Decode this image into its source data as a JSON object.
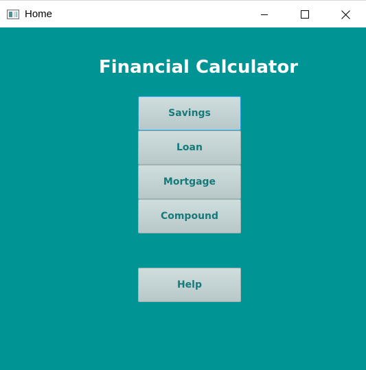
{
  "window": {
    "title": "Home",
    "controls": {
      "minimize_icon": "minimize-icon",
      "maximize_icon": "maximize-icon",
      "close_icon": "close-icon"
    }
  },
  "main": {
    "heading": "Financial Calculator",
    "buttons": [
      {
        "label": "Savings",
        "focused": true
      },
      {
        "label": "Loan",
        "focused": false
      },
      {
        "label": "Mortgage",
        "focused": false
      },
      {
        "label": "Compound",
        "focused": false
      }
    ],
    "help_button": {
      "label": "Help"
    }
  },
  "colors": {
    "background": "#009494",
    "heading_text": "#ffffff",
    "button_text": "#167a7a",
    "button_face": "#c4d4d4",
    "focus_border": "#2a9ad6"
  }
}
